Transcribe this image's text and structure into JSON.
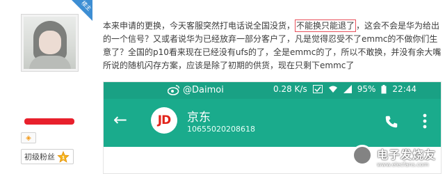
{
  "user": {
    "corner_tag": "楼主",
    "level_label": "初级粉丝",
    "level_badge": "1"
  },
  "post": {
    "line1_before": "本来申请的更换，今天客服突然打电话说全国没货，",
    "line1_highlight": "不能换只能退了",
    "line1_after": "，这会不会是华为给出",
    "line2": "的一个信号？又或者说华为已经放弃一部分客户了，凡是觉得忍受不了emmc的不做你们生",
    "line3": "意了？全国的p10看来现在已经没有ufs的了，全是emmc的了，所以不敢换，并没有余大嘴",
    "line4": "所说的随机闪存方案，应该是除了初期的供货，现在只剩下emmc了"
  },
  "phone": {
    "status_handle": "@Daimoi",
    "status_speed": "0.28 K/s",
    "status_battery": "95%",
    "status_time": "22:44",
    "contact_logo": "JD",
    "contact_name": "京东",
    "contact_number": "10655020208618",
    "colors": {
      "status": "#19a184",
      "appbar": "#1aab8c",
      "logo": "#e2231a"
    }
  },
  "watermark": {
    "text": "电子发烧友",
    "url": "www.elecfans.com"
  }
}
